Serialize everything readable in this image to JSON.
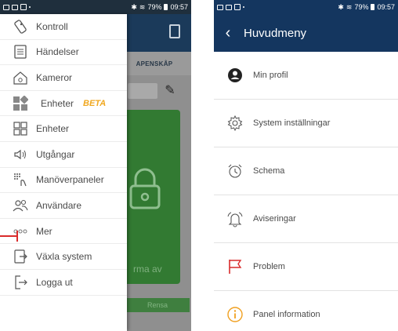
{
  "left_phone": {
    "status_bar": {
      "battery": "79%",
      "time": "09:57"
    },
    "background_app": {
      "tab_label": "APENSKÅP",
      "panel_text": "rma av",
      "rensa_label": "Rensa"
    },
    "drawer": {
      "items": [
        {
          "label": "Kontroll",
          "icon": "remote-control-icon"
        },
        {
          "label": "Händelser",
          "icon": "event-list-icon"
        },
        {
          "label": "Kameror",
          "icon": "camera-house-icon"
        },
        {
          "label": "Enheter",
          "badge": "BETA",
          "icon": "devices-beta-icon"
        },
        {
          "label": "Enheter",
          "icon": "devices-grid-icon"
        },
        {
          "label": "Utgångar",
          "icon": "outputs-speaker-icon"
        },
        {
          "label": "Manöverpaneler",
          "icon": "keypad-icon"
        },
        {
          "label": "Användare",
          "icon": "users-icon"
        },
        {
          "label": "Mer",
          "icon": "more-dots-icon"
        },
        {
          "label": "Växla system",
          "icon": "switch-system-icon"
        },
        {
          "label": "Logga ut",
          "icon": "logout-icon"
        }
      ]
    },
    "colors": {
      "beta": "#f0a820",
      "marker": "#d92b2b"
    }
  },
  "right_phone": {
    "status_bar": {
      "battery": "79%",
      "time": "09:57"
    },
    "header": {
      "title": "Huvudmeny",
      "back_icon": "back-chevron-icon"
    },
    "menu": [
      {
        "label": "Min profil",
        "icon": "profile-icon"
      },
      {
        "label": "System inställningar",
        "icon": "settings-gear-icon"
      },
      {
        "label": "Schema",
        "icon": "alarm-clock-icon"
      },
      {
        "label": "Aviseringar",
        "icon": "notification-bell-icon"
      },
      {
        "label": "Problem",
        "icon": "flag-icon"
      },
      {
        "label": "Panel information",
        "icon": "info-icon"
      }
    ],
    "colors": {
      "header": "#14365f",
      "problem": "#d92b2b",
      "info": "#f0a020"
    }
  }
}
